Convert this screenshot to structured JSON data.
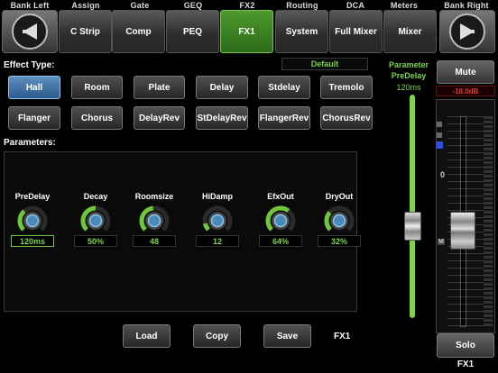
{
  "nav": {
    "bank_left": "Bank Left",
    "bank_right": "Bank Right",
    "tabs": [
      {
        "top": "Assign",
        "label": "C Strip"
      },
      {
        "top": "Gate",
        "label": "Comp"
      },
      {
        "top": "GEQ",
        "label": "PEQ"
      },
      {
        "top": "FX2",
        "label": "FX1"
      },
      {
        "top": "Routing",
        "label": "System"
      },
      {
        "top": "DCA",
        "label": "Full Mixer"
      },
      {
        "top": "Meters",
        "label": "Mixer"
      }
    ]
  },
  "effect": {
    "heading": "Effect Type:",
    "preset": "Default",
    "types": [
      "Hall",
      "Room",
      "Plate",
      "Delay",
      "Stdelay",
      "Tremolo",
      "Flanger",
      "Chorus",
      "DelayRev",
      "StDelayRev",
      "FlangerRev",
      "ChorusRev"
    ],
    "selected": "Hall"
  },
  "parameters": {
    "heading": "Parameters:",
    "knobs": [
      {
        "name": "PreDelay",
        "value": "120ms",
        "level": 0.35
      },
      {
        "name": "Decay",
        "value": "50%",
        "level": 0.5
      },
      {
        "name": "Roomsize",
        "value": "48",
        "level": 0.48
      },
      {
        "name": "HiDamp",
        "value": "12",
        "level": 0.12
      },
      {
        "name": "EfxOut",
        "value": "64%",
        "level": 0.64
      },
      {
        "name": "DryOut",
        "value": "32%",
        "level": 0.32
      }
    ]
  },
  "param_slider": {
    "title1": "Parameter",
    "title2": "PreDelay",
    "value": "120ms",
    "level": 0.4
  },
  "channel": {
    "mute": "Mute",
    "level_readout": "-18.0dB",
    "zero_mark": "0",
    "m_mark": "M",
    "fader_level": 0.45,
    "solo": "Solo",
    "name": "FX1"
  },
  "actions": {
    "load": "Load",
    "copy": "Copy",
    "save": "Save",
    "current": "FX1"
  },
  "colors": {
    "accent_green": "#6ec63a",
    "selected_blue": "#3d74ad",
    "meter_red": "#d62020"
  }
}
